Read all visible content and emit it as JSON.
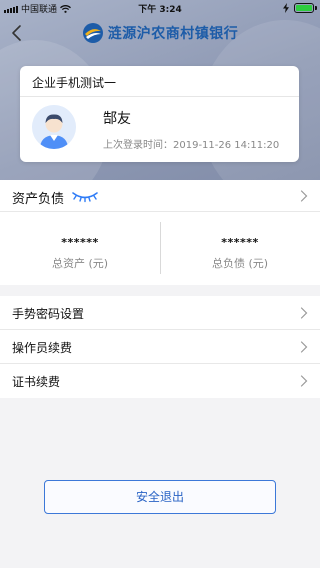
{
  "status_bar": {
    "carrier": "中国联通",
    "time": "下午 3:24"
  },
  "header": {
    "bank_name": "涟源沪农商村镇银行",
    "back_icon": "chevron-left-icon",
    "logo_icon": "bank-logo-icon"
  },
  "user_card": {
    "company": "企业手机测试一",
    "user_name": "郜友",
    "last_login": "上次登录时间：2019-11-26 14:11:20"
  },
  "assets": {
    "title": "资产负债",
    "visibility_icon": "eye-closed-icon",
    "total_assets_value": "******",
    "total_assets_label": "总资产 (元)",
    "total_liabilities_value": "******",
    "total_liabilities_label": "总负债 (元)"
  },
  "menu": {
    "items": [
      {
        "label": "手势密码设置"
      },
      {
        "label": "操作员续费"
      },
      {
        "label": "证书续费"
      }
    ]
  },
  "logout_label": "安全退出",
  "colors": {
    "brand": "#1d5ca8",
    "accent": "#2a64c5",
    "battery": "#2ecc40"
  }
}
